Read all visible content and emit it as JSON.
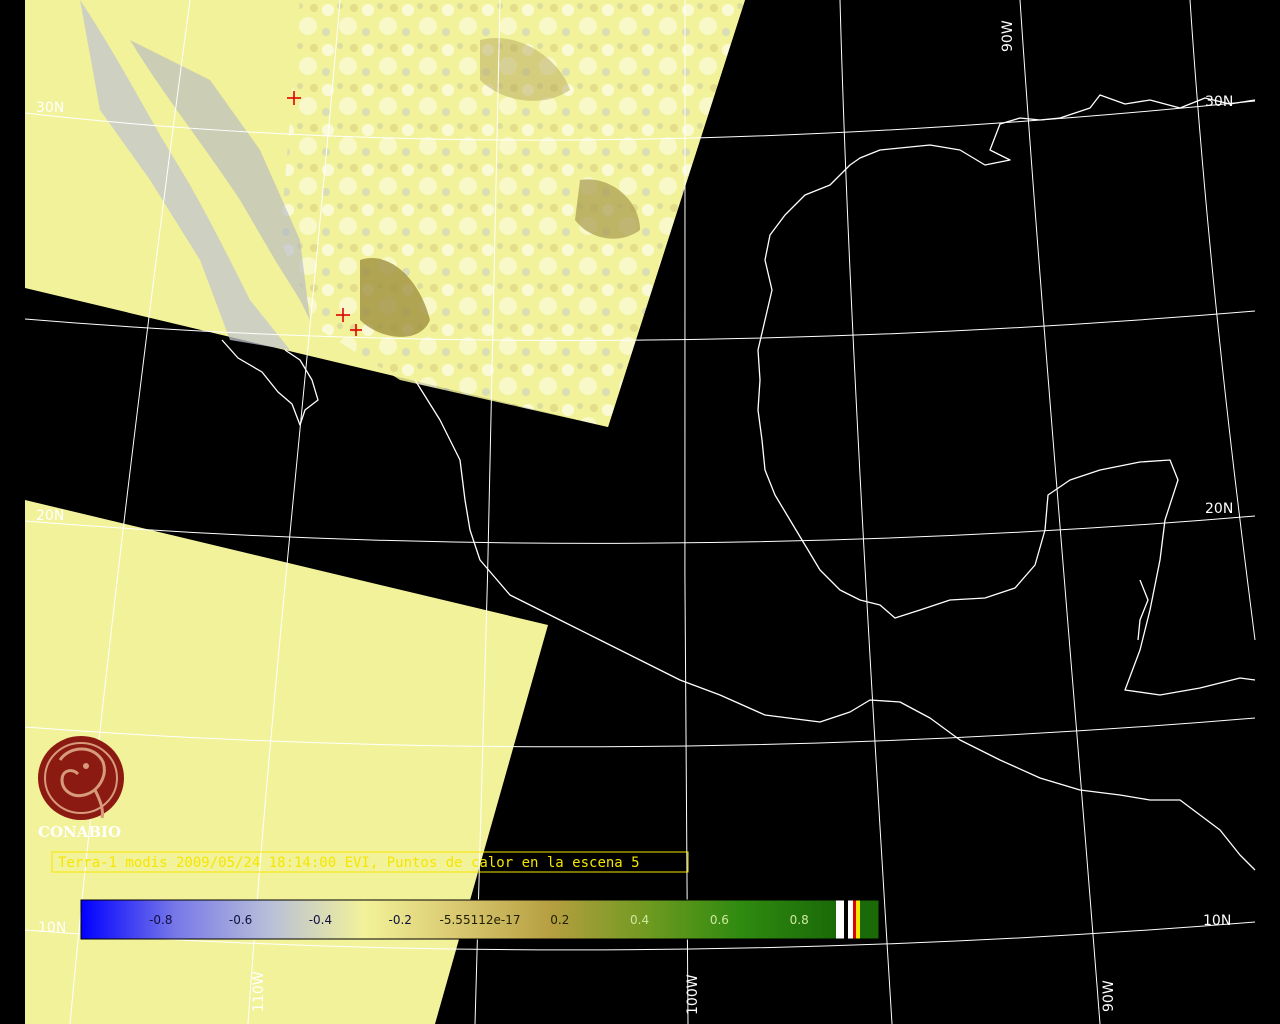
{
  "colors": {
    "background": "#000000",
    "scene_yellow": "#f2f29a",
    "grid": "#ffffff",
    "coast": "#ffffff",
    "hotspot": "#e00000",
    "caption": "#f5e600",
    "logo": "#8b1a12"
  },
  "logo": {
    "icon": "conabio-logo-icon",
    "text": "CONABIO"
  },
  "caption": "Terra-1 modis 2009/05/24 18:14:00 EVI, Puntos de calor en la escena 5",
  "grid_labels": {
    "lat_30n_left": "30N",
    "lat_30n_right": "30N",
    "lat_20n_left": "20N",
    "lat_20n_right": "20N",
    "lat_10n_left": "10N",
    "lat_10n_right": "10N",
    "lon_90w_top": "90W",
    "lon_90w_bottom": "90W",
    "lon_100w_bottom": "100W",
    "lon_110w_bottom": "110W"
  },
  "colorbar": {
    "ticks": [
      "-0.8",
      "-0.6",
      "-0.4",
      "-0.2",
      "-5.55112e-17",
      "0.2",
      "0.4",
      "0.6",
      "0.8"
    ],
    "tick_values": [
      -0.8,
      -0.6,
      -0.4,
      -0.2,
      -5.55112e-17,
      0.2,
      0.4,
      0.6,
      0.8
    ],
    "range": [
      -1,
      1
    ],
    "gradient": [
      "#0000ff",
      "#7878e8",
      "#b8bfd8",
      "#f2f29a",
      "#d9c870",
      "#b59e40",
      "#6f9a20",
      "#2f8a10",
      "#1a6a08"
    ],
    "special_swatches": [
      "#ffffff",
      "#000000",
      "#ffffff",
      "#e00000",
      "#f5e600"
    ]
  },
  "hotspots": [
    {
      "label": "hotspot-1"
    },
    {
      "label": "hotspot-2"
    },
    {
      "label": "hotspot-3"
    }
  ]
}
